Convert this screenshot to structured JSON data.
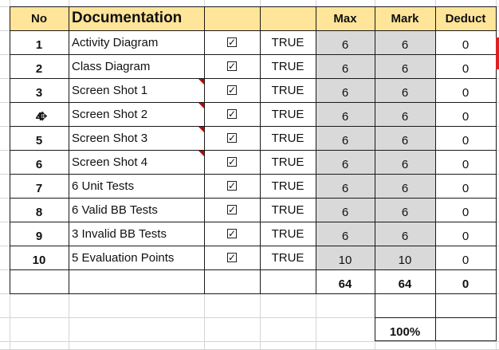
{
  "header": {
    "no": "No",
    "documentation": "Documentation",
    "max": "Max",
    "mark": "Mark",
    "deduct": "Deduct"
  },
  "rows": [
    {
      "no": "1",
      "item": "Activity Diagram",
      "check": "✓",
      "status": "TRUE",
      "max": "6",
      "mark": "6",
      "deduct": "0"
    },
    {
      "no": "2",
      "item": "Class Diagram",
      "check": "✓",
      "status": "TRUE",
      "max": "6",
      "mark": "6",
      "deduct": "0"
    },
    {
      "no": "3",
      "item": "Screen Shot 1",
      "check": "✓",
      "status": "TRUE",
      "max": "6",
      "mark": "6",
      "deduct": "0"
    },
    {
      "no": "4",
      "item": "Screen Shot 2",
      "check": "✓",
      "status": "TRUE",
      "max": "6",
      "mark": "6",
      "deduct": "0"
    },
    {
      "no": "5",
      "item": "Screen Shot 3",
      "check": "✓",
      "status": "TRUE",
      "max": "6",
      "mark": "6",
      "deduct": "0"
    },
    {
      "no": "6",
      "item": "Screen Shot 4",
      "check": "✓",
      "status": "TRUE",
      "max": "6",
      "mark": "6",
      "deduct": "0"
    },
    {
      "no": "7",
      "item": "6 Unit Tests",
      "check": "✓",
      "status": "TRUE",
      "max": "6",
      "mark": "6",
      "deduct": "0"
    },
    {
      "no": "8",
      "item": "6 Valid BB Tests",
      "check": "✓",
      "status": "TRUE",
      "max": "6",
      "mark": "6",
      "deduct": "0"
    },
    {
      "no": "9",
      "item": "3 Invalid BB Tests",
      "check": "✓",
      "status": "TRUE",
      "max": "6",
      "mark": "6",
      "deduct": "0"
    },
    {
      "no": "10",
      "item": "5 Evaluation Points",
      "check": "✓",
      "status": "TRUE",
      "max": "10",
      "mark": "10",
      "deduct": "0"
    }
  ],
  "totals": {
    "max": "64",
    "mark": "64",
    "deduct": "0"
  },
  "percentage": "100%",
  "colors": {
    "header_fill": "#ffe599",
    "value_fill": "#d9d9d9",
    "comment_marker": "#c00000",
    "scroll_marker": "#e02020"
  },
  "icons": {
    "cursor": "move-cursor-icon",
    "checkbox": "checkbox-checked-icon"
  }
}
